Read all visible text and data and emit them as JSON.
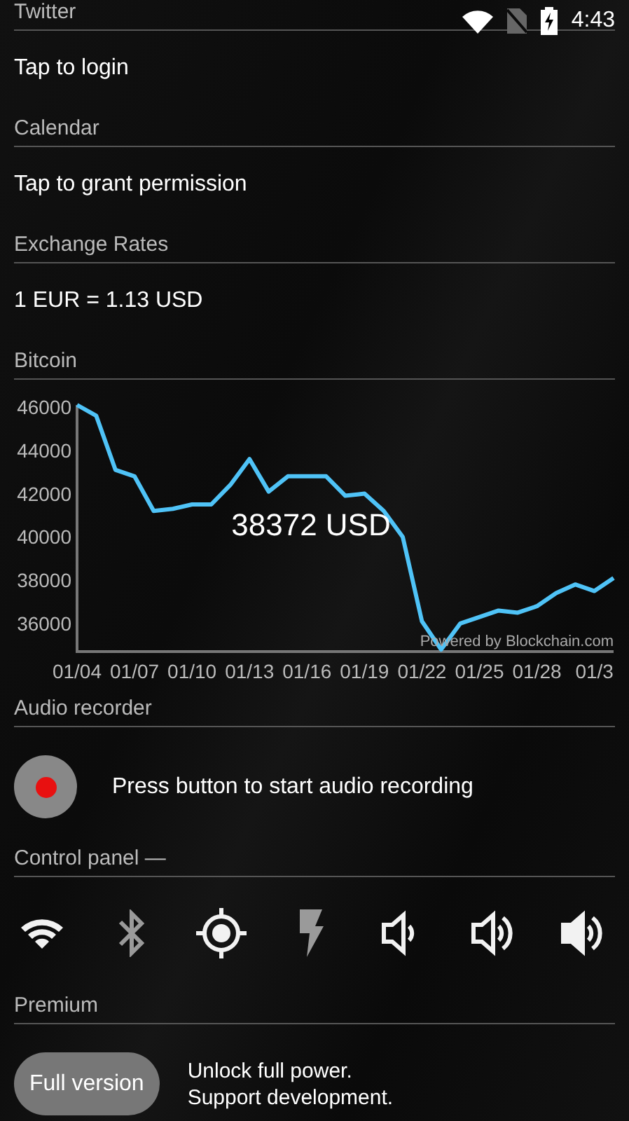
{
  "status_bar": {
    "time": "4:43"
  },
  "sections": [
    {
      "kind": "text",
      "title": "Twitter",
      "text": "Tap to login"
    },
    {
      "kind": "text",
      "title": "Calendar",
      "text": "Tap to grant permission"
    },
    {
      "kind": "text",
      "title": "Exchange Rates",
      "text": "1 EUR = 1.13 USD"
    },
    {
      "kind": "chart",
      "title": "Bitcoin",
      "price": "38372 USD",
      "credit": "Powered by Blockchain.com",
      "chart_data": {
        "type": "line",
        "categories": [
          "01/04",
          null,
          null,
          "01/07",
          null,
          null,
          "01/10",
          null,
          null,
          "01/13",
          null,
          null,
          "01/16",
          null,
          null,
          "01/19",
          null,
          null,
          "01/22",
          null,
          null,
          "01/25",
          null,
          null,
          "01/28",
          null,
          null,
          "01/3",
          null
        ],
        "series": [
          {
            "color": "#4fc3f7",
            "values": [
              46100,
              45600,
              43100,
              42800,
              41200,
              41300,
              41500,
              41500,
              42400,
              43600,
              42100,
              42800,
              42800,
              42800,
              41900,
              42000,
              41200,
              40000,
              36100,
              34800,
              36000,
              36300,
              36600,
              36500,
              36800,
              37400,
              37800,
              37500,
              38100
            ]
          }
        ],
        "ylim": [
          34700,
          46100
        ],
        "yticks": [
          36000,
          38000,
          40000,
          42000,
          44000,
          46000
        ]
      }
    },
    {
      "kind": "recorder",
      "title": "Audio recorder",
      "text": "Press button to start audio recording"
    },
    {
      "kind": "controls",
      "title": "Control panel —",
      "controls": [
        {
          "kind": "wifi",
          "on": true
        },
        {
          "kind": "bluetooth",
          "on": false
        },
        {
          "kind": "location",
          "on": true
        },
        {
          "kind": "flash",
          "on": false
        },
        {
          "kind": "volume-low",
          "on": true
        },
        {
          "kind": "volume-medium",
          "on": true
        },
        {
          "kind": "volume-high",
          "on": true
        }
      ]
    },
    {
      "kind": "premium",
      "title": "Premium",
      "button": "Full version",
      "lines": [
        "Unlock full power.",
        "Support development."
      ]
    }
  ]
}
